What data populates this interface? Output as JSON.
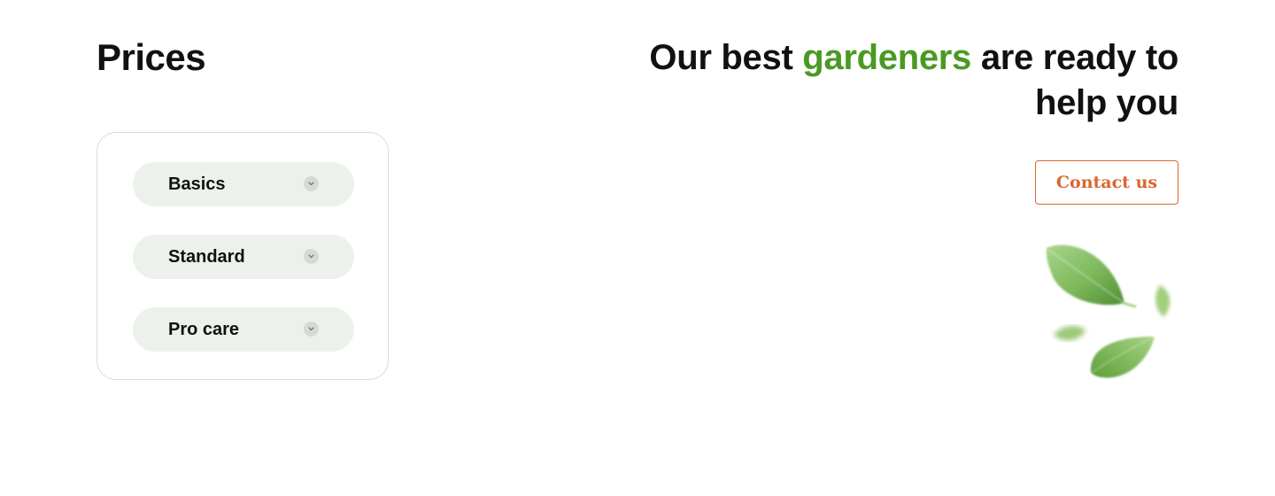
{
  "prices": {
    "title": "Prices",
    "plans": [
      {
        "label": "Basics",
        "icon": "chevron-down-icon"
      },
      {
        "label": "Standard",
        "icon": "chevron-down-icon"
      },
      {
        "label": "Pro care",
        "icon": "chevron-down-icon"
      }
    ]
  },
  "hero": {
    "headline_before": "Our best ",
    "headline_accent": "gardeners",
    "headline_after": " are ready to help you",
    "contact_label": "Contact us"
  },
  "colors": {
    "accent_green": "#4a9a22",
    "contact_orange": "#d9682f",
    "plan_background": "#edf1ec",
    "card_border": "#dcdcdc"
  }
}
